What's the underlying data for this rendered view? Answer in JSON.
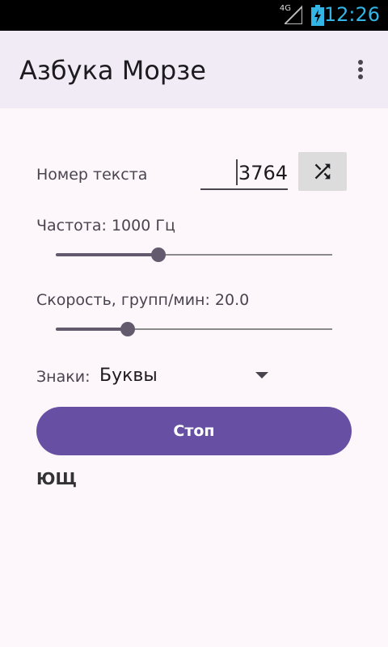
{
  "status_bar": {
    "network": "4G",
    "time": "12:26"
  },
  "app_bar": {
    "title": "Азбука Морзе"
  },
  "text_number": {
    "label": "Номер текста",
    "value": "3764"
  },
  "frequency": {
    "label": "Частота: 1000 Гц",
    "slider_fraction": 0.37
  },
  "speed": {
    "label": "Скорость, групп/мин: 20.0",
    "slider_fraction": 0.26
  },
  "signs": {
    "label": "Знаки:",
    "selected": "Буквы"
  },
  "stop_button": {
    "label": "Стоп"
  },
  "output": {
    "text": "ЮЩ"
  },
  "colors": {
    "accent": "#6750a4",
    "slider": "#645a6e",
    "clock": "#33b5e5"
  }
}
